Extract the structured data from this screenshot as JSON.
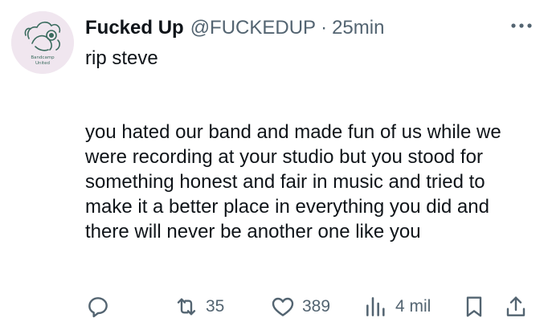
{
  "author": {
    "name": "Fucked Up",
    "handle": "@FUCKEDUP",
    "separator": "·",
    "time": "25min",
    "avatar_caption": "Bandcamp United"
  },
  "tweet": {
    "text_line1": "rip steve",
    "text_paragraph": "you hated our band and made fun of us while we were recording at your studio but you stood for something honest and fair in music and tried to make it a better place in everything you did and there will never be another one like you"
  },
  "actions": {
    "reply_icon": "reply-icon",
    "repost_count": "35",
    "like_count": "389",
    "views_count": "4 mil"
  },
  "colors": {
    "text": "#0f1419",
    "secondary": "#536471",
    "avatar_bg": "#f0e6ef",
    "avatar_ink": "#3a6b5e"
  }
}
